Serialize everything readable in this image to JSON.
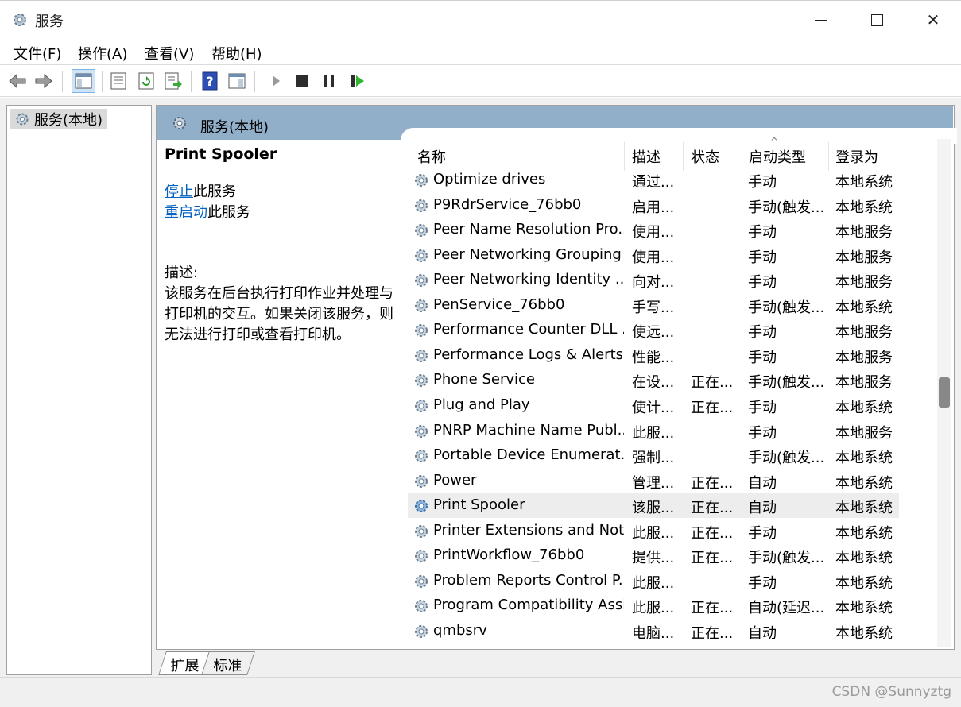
{
  "window": {
    "title": "服务"
  },
  "menu": [
    "文件(F)",
    "操作(A)",
    "查看(V)",
    "帮助(H)"
  ],
  "toolbar": {
    "buttons": [
      "back-icon",
      "forward-icon",
      "console-tree-icon",
      "properties-icon",
      "refresh-icon",
      "export-list-icon",
      "help-icon",
      "show-hide-action-pane-icon",
      "start-service-icon",
      "stop-service-icon",
      "pause-service-icon",
      "restart-service-icon"
    ]
  },
  "tree": {
    "root_label": "服务(本地)"
  },
  "pane_header": {
    "label": "服务(本地)"
  },
  "details": {
    "service_name": "Print Spooler",
    "stop_link": "停止",
    "stop_suffix": "此服务",
    "restart_link": "重启动",
    "restart_suffix": "此服务",
    "desc_label": "描述:",
    "desc_lines": [
      "该服务在后台执行打印作业并处理与",
      "打印机的交互。如果关闭该服务，则",
      "无法进行打印或查看打印机。"
    ]
  },
  "columns": {
    "name": "名称",
    "desc": "描述",
    "status": "状态",
    "startup": "启动类型",
    "logon": "登录为"
  },
  "services": [
    {
      "name": "Optimize drives",
      "desc": "通过...",
      "status": "",
      "startup": "手动",
      "logon": "本地系统"
    },
    {
      "name": "P9RdrService_76bb0",
      "desc": "启用...",
      "status": "",
      "startup": "手动(触发...",
      "logon": "本地系统"
    },
    {
      "name": "Peer Name Resolution Pro...",
      "desc": "使用...",
      "status": "",
      "startup": "手动",
      "logon": "本地服务"
    },
    {
      "name": "Peer Networking Grouping",
      "desc": "使用...",
      "status": "",
      "startup": "手动",
      "logon": "本地服务"
    },
    {
      "name": "Peer Networking Identity ...",
      "desc": "向对...",
      "status": "",
      "startup": "手动",
      "logon": "本地服务"
    },
    {
      "name": "PenService_76bb0",
      "desc": "手写...",
      "status": "",
      "startup": "手动(触发...",
      "logon": "本地系统"
    },
    {
      "name": "Performance Counter DLL ...",
      "desc": "使远...",
      "status": "",
      "startup": "手动",
      "logon": "本地服务"
    },
    {
      "name": "Performance Logs & Alerts",
      "desc": "性能...",
      "status": "",
      "startup": "手动",
      "logon": "本地服务"
    },
    {
      "name": "Phone Service",
      "desc": "在设...",
      "status": "正在...",
      "startup": "手动(触发...",
      "logon": "本地服务"
    },
    {
      "name": "Plug and Play",
      "desc": "使计...",
      "status": "正在...",
      "startup": "手动",
      "logon": "本地系统"
    },
    {
      "name": "PNRP Machine Name Publ...",
      "desc": "此服...",
      "status": "",
      "startup": "手动",
      "logon": "本地服务"
    },
    {
      "name": "Portable Device Enumerat...",
      "desc": "强制...",
      "status": "",
      "startup": "手动(触发...",
      "logon": "本地系统"
    },
    {
      "name": "Power",
      "desc": "管理...",
      "status": "正在...",
      "startup": "自动",
      "logon": "本地系统"
    },
    {
      "name": "Print Spooler",
      "desc": "该服...",
      "status": "正在...",
      "startup": "自动",
      "logon": "本地系统",
      "selected": true
    },
    {
      "name": "Printer Extensions and Noti...",
      "desc": "此服...",
      "status": "正在...",
      "startup": "手动",
      "logon": "本地系统"
    },
    {
      "name": "PrintWorkflow_76bb0",
      "desc": "提供...",
      "status": "正在...",
      "startup": "手动(触发...",
      "logon": "本地系统"
    },
    {
      "name": "Problem Reports Control P...",
      "desc": "此服...",
      "status": "",
      "startup": "手动",
      "logon": "本地系统"
    },
    {
      "name": "Program Compatibility Assi...",
      "desc": "此服...",
      "status": "正在...",
      "startup": "自动(延迟...",
      "logon": "本地系统"
    },
    {
      "name": "qmbsrv",
      "desc": "电脑...",
      "status": "正在...",
      "startup": "自动",
      "logon": "本地系统"
    }
  ],
  "tabs": [
    "扩展",
    "标准"
  ],
  "watermark": "CSDN @Sunnyztg"
}
